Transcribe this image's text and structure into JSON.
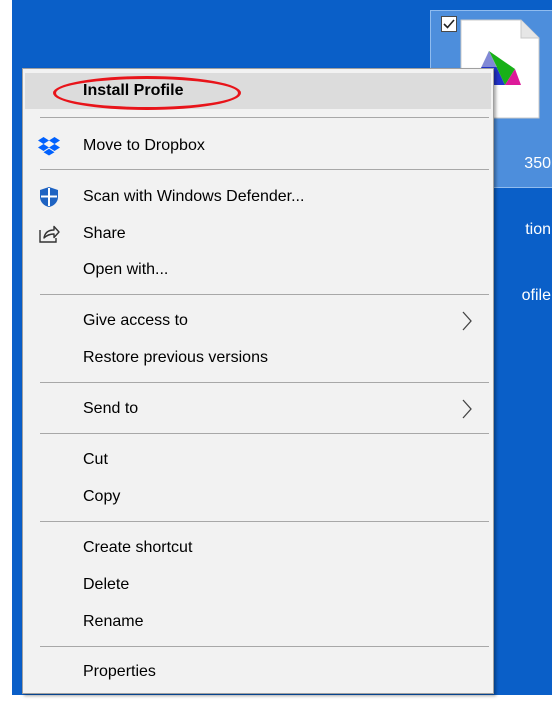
{
  "desktop": {
    "background_color": "#0a5fc8",
    "selected_file": {
      "label_lines": [
        "350",
        "tion",
        "ofile"
      ],
      "icon": "color-profile-file-icon",
      "checked": true
    }
  },
  "context_menu": {
    "items": {
      "install_profile": "Install Profile",
      "move_to_dropbox": "Move to Dropbox",
      "scan_defender": "Scan with Windows Defender...",
      "share": "Share",
      "open_with": "Open with...",
      "give_access": "Give access to",
      "restore_versions": "Restore previous versions",
      "send_to": "Send to",
      "cut": "Cut",
      "copy": "Copy",
      "create_shortcut": "Create shortcut",
      "delete": "Delete",
      "rename": "Rename",
      "properties": "Properties"
    },
    "icons": {
      "dropbox": "dropbox-icon",
      "defender": "windows-defender-icon",
      "share": "share-icon",
      "submenu": "chevron-right-icon"
    },
    "highlight_color": "#dcdcdc",
    "annotation_color": "#e8141a"
  }
}
